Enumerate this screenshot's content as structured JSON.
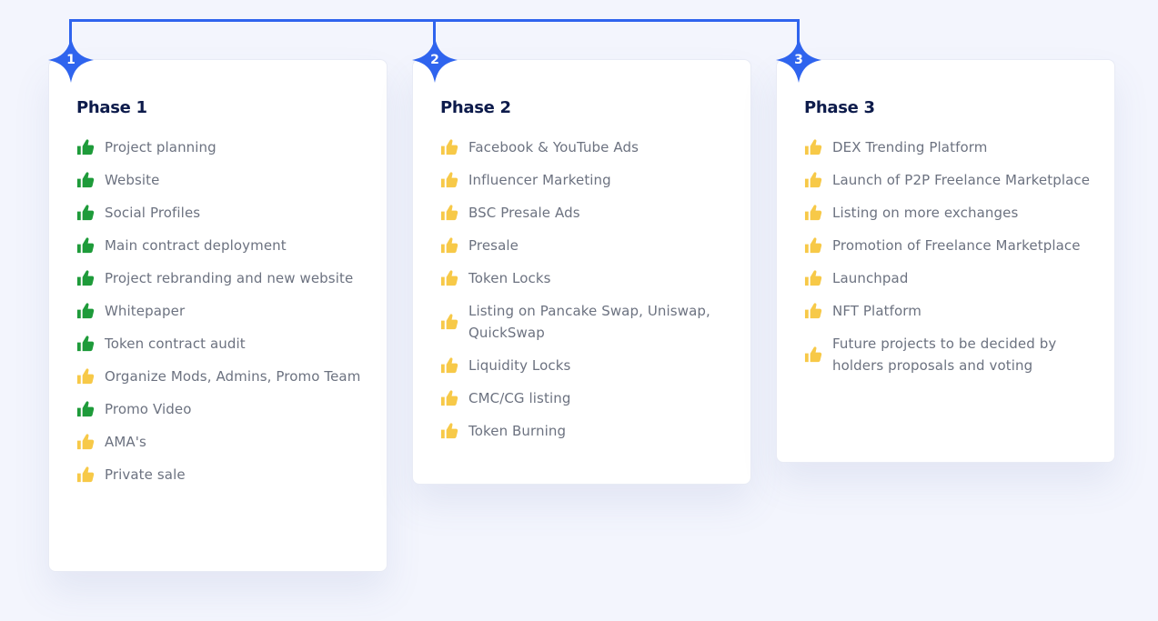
{
  "colors": {
    "accent": "#2f64ee",
    "done": "#1e9b3a",
    "pending": "#f7c948"
  },
  "phases": [
    {
      "number": "1",
      "title": "Phase 1",
      "items": [
        {
          "label": "Project planning",
          "status": "done"
        },
        {
          "label": "Website",
          "status": "done"
        },
        {
          "label": "Social Profiles",
          "status": "done"
        },
        {
          "label": "Main contract deployment",
          "status": "done"
        },
        {
          "label": "Project rebranding and new website",
          "status": "done"
        },
        {
          "label": "Whitepaper",
          "status": "done"
        },
        {
          "label": "Token contract audit",
          "status": "done"
        },
        {
          "label": "Organize Mods, Admins, Promo Team",
          "status": "pending"
        },
        {
          "label": "Promo Video",
          "status": "done"
        },
        {
          "label": "AMA's",
          "status": "pending"
        },
        {
          "label": "Private sale",
          "status": "pending"
        }
      ]
    },
    {
      "number": "2",
      "title": "Phase 2",
      "items": [
        {
          "label": "Facebook & YouTube Ads",
          "status": "pending"
        },
        {
          "label": "Influencer Marketing",
          "status": "pending"
        },
        {
          "label": "BSC Presale Ads",
          "status": "pending"
        },
        {
          "label": "Presale",
          "status": "pending"
        },
        {
          "label": "Token Locks",
          "status": "pending"
        },
        {
          "label": "Listing on Pancake Swap, Uniswap, QuickSwap",
          "status": "pending"
        },
        {
          "label": "Liquidity Locks",
          "status": "pending"
        },
        {
          "label": "CMC/CG listing",
          "status": "pending"
        },
        {
          "label": "Token Burning",
          "status": "pending"
        }
      ]
    },
    {
      "number": "3",
      "title": "Phase 3",
      "items": [
        {
          "label": "DEX Trending Platform",
          "status": "pending"
        },
        {
          "label": "Launch of P2P Freelance Marketplace",
          "status": "pending"
        },
        {
          "label": "Listing on more exchanges",
          "status": "pending"
        },
        {
          "label": "Promotion of Freelance Marketplace",
          "status": "pending"
        },
        {
          "label": "Launchpad",
          "status": "pending"
        },
        {
          "label": "NFT Platform",
          "status": "pending"
        },
        {
          "label": "Future projects to be decided by holders proposals and voting",
          "status": "pending"
        }
      ]
    }
  ]
}
